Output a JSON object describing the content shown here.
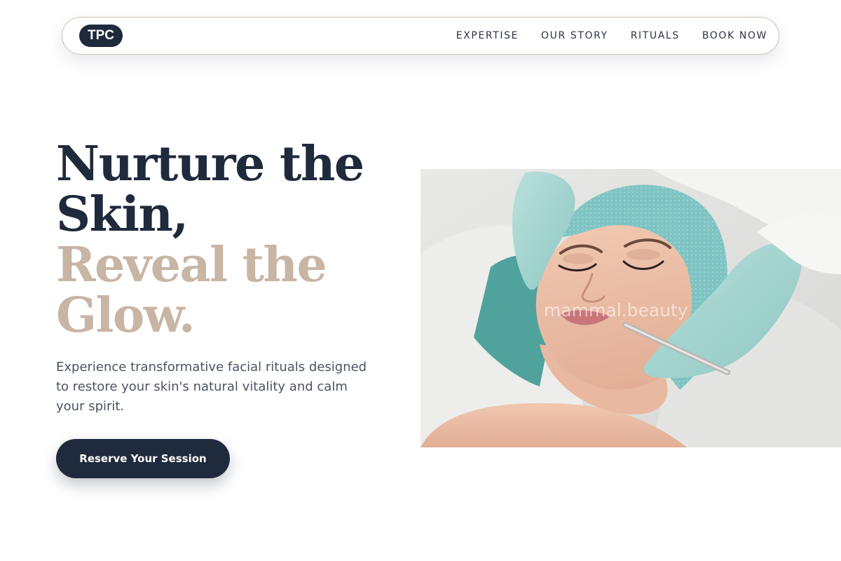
{
  "nav": {
    "logo": "TPC",
    "links": [
      "EXPERTISE",
      "OUR STORY",
      "RITUALS",
      "BOOK NOW"
    ]
  },
  "hero": {
    "title_lines_dark": [
      "Nurture the",
      "Skin,"
    ],
    "title_lines_accent": [
      "Reveal the",
      "Glow."
    ],
    "description": "Experience transformative facial rituals designed to restore your skin's natural vitality and calm your spirit.",
    "cta_label": "Reserve Your Session",
    "image_watermark": "mammal.beauty"
  },
  "colors": {
    "navy": "#1f2a3c",
    "accent_beige": "#c8b5a3",
    "body_text": "#4a5464"
  }
}
